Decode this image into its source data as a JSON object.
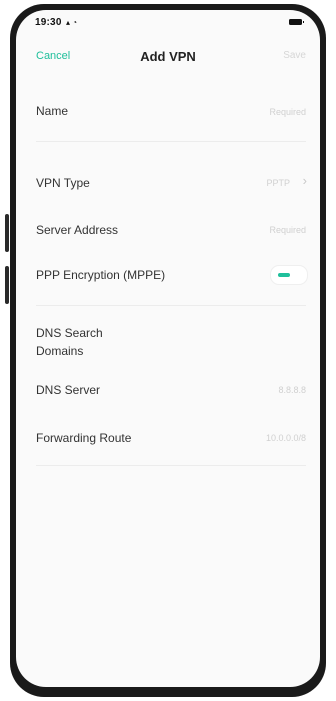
{
  "status_bar": {
    "time": "19:30",
    "signal_icons": "signal-wifi-icons",
    "battery_icon": "battery-icon"
  },
  "nav": {
    "cancel_label": "Cancel",
    "title": "Add VPN",
    "save_label": "Save"
  },
  "fields": {
    "name": {
      "label": "Name",
      "placeholder": "Required"
    },
    "vpn_type": {
      "label": "VPN Type",
      "value": "PPTP"
    },
    "server_address": {
      "label": "Server Address",
      "placeholder": "Required"
    },
    "ppp_encryption": {
      "label": "PPP Encryption (MPPE)",
      "enabled": true
    },
    "dns_search_domains": {
      "label_line1": "DNS Search",
      "label_line2": "Domains"
    },
    "dns_server": {
      "label": "DNS Server",
      "placeholder": "8.8.8.8"
    },
    "forwarding_route": {
      "label": "Forwarding Route",
      "placeholder": "10.0.0.0/8"
    }
  },
  "colors": {
    "accent": "#1fbf9b",
    "disabled_text": "#d6d6d6",
    "label_text": "#333333"
  }
}
